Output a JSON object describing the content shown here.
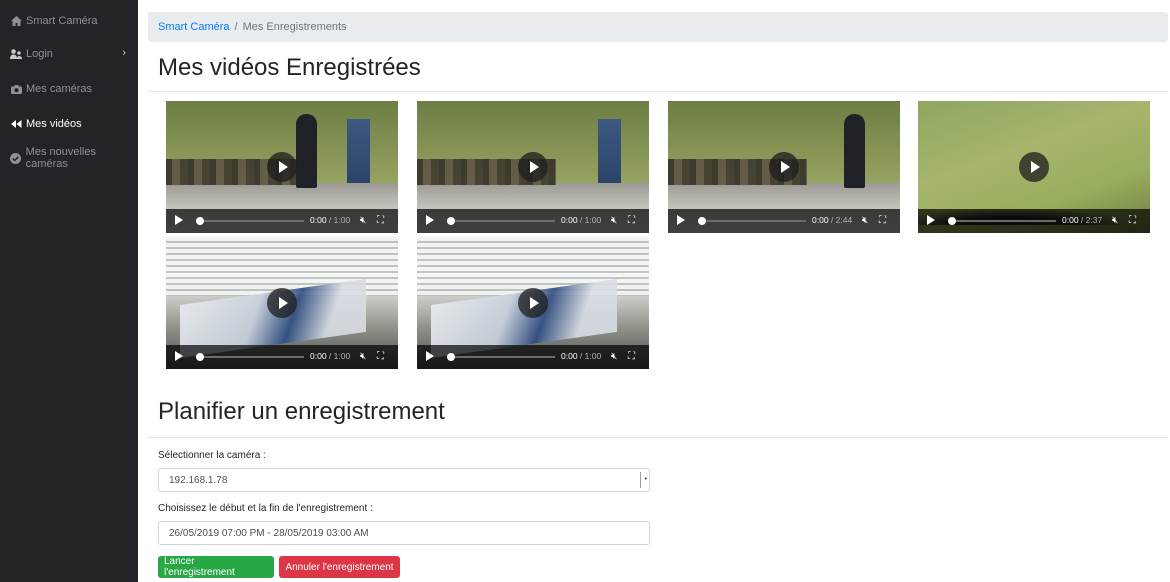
{
  "sidebar": {
    "items": [
      {
        "label": "Smart Caméra",
        "icon": "home-icon",
        "active": false
      },
      {
        "label": "Login",
        "icon": "users-icon",
        "active": false,
        "has_submenu": true
      },
      {
        "label": "Mes caméras",
        "icon": "camera-icon",
        "active": false
      },
      {
        "label": "Mes vidéos",
        "icon": "backward-icon",
        "active": true
      },
      {
        "label": "Mes nouvelles caméras",
        "icon": "check-circle-icon",
        "active": false
      }
    ]
  },
  "breadcrumb": {
    "root": "Smart Caméra",
    "separator": "/",
    "current": "Mes Enregistrements"
  },
  "videos_section": {
    "title": "Mes vidéos Enregistrées",
    "videos": [
      {
        "scene": "classroom",
        "current": "0:00",
        "duration": "1:00"
      },
      {
        "scene": "classroom",
        "current": "0:00",
        "duration": "1:00"
      },
      {
        "scene": "classroom",
        "current": "0:00",
        "duration": "2:44"
      },
      {
        "scene": "wall",
        "current": "0:00",
        "duration": "2:37"
      },
      {
        "scene": "window",
        "current": "0:00",
        "duration": "1:00"
      },
      {
        "scene": "window",
        "current": "0:00",
        "duration": "1:00"
      }
    ]
  },
  "schedule_section": {
    "title": "Planifier un enregistrement",
    "camera_label": "Sélectionner la caméra :",
    "camera_value": "192.168.1.78",
    "range_label": "Choisissez le début et la fin de l'enregistrement :",
    "range_value": "26/05/2019 07:00 PM - 28/05/2019 03:00 AM",
    "start_button": "Lancer l'enregistrement",
    "cancel_button": "Annuler l'enregistrement"
  },
  "colors": {
    "sidebar_bg": "#222428",
    "link": "#007bff",
    "success": "#28a745",
    "danger": "#dc3545"
  }
}
